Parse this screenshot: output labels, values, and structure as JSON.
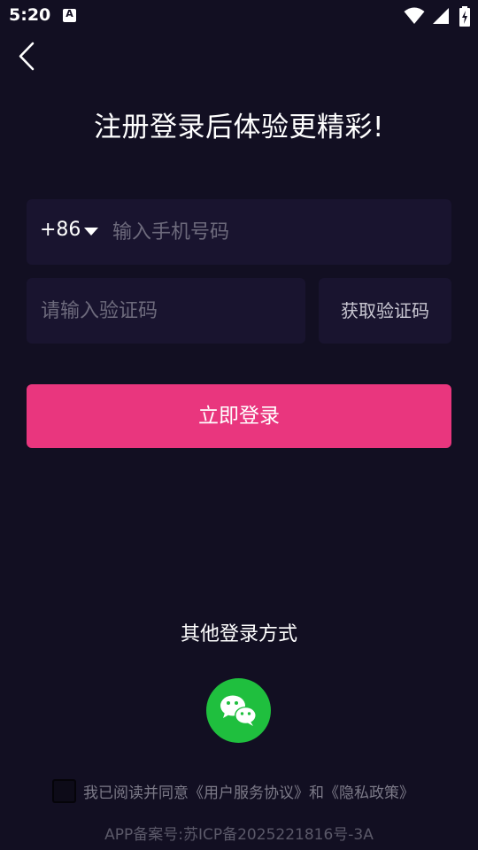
{
  "status_bar": {
    "time": "5:20",
    "notification_icon_letter": "A",
    "icons": [
      "wifi-icon",
      "signal-icon",
      "battery-icon"
    ]
  },
  "header": {
    "back_icon": "chevron-left-icon",
    "title": "注册登录后体验更精彩!"
  },
  "phone": {
    "country_code": "+86",
    "placeholder": "输入手机号码",
    "value": ""
  },
  "verification": {
    "placeholder": "请输入验证码",
    "value": "",
    "get_code_label": "获取验证码"
  },
  "login": {
    "button_label": "立即登录"
  },
  "other_login": {
    "title": "其他登录方式",
    "wechat_icon": "wechat-icon"
  },
  "agreement": {
    "checked": false,
    "text": "我已阅读并同意《用户服务协议》和《隐私政策》"
  },
  "footer": {
    "icp": "APP备案号:苏ICP备2025221816号-3A"
  },
  "colors": {
    "background": "#120f22",
    "field_background": "#19142f",
    "primary_button": "#e9367e",
    "wechat_green": "#1fbf3e"
  }
}
